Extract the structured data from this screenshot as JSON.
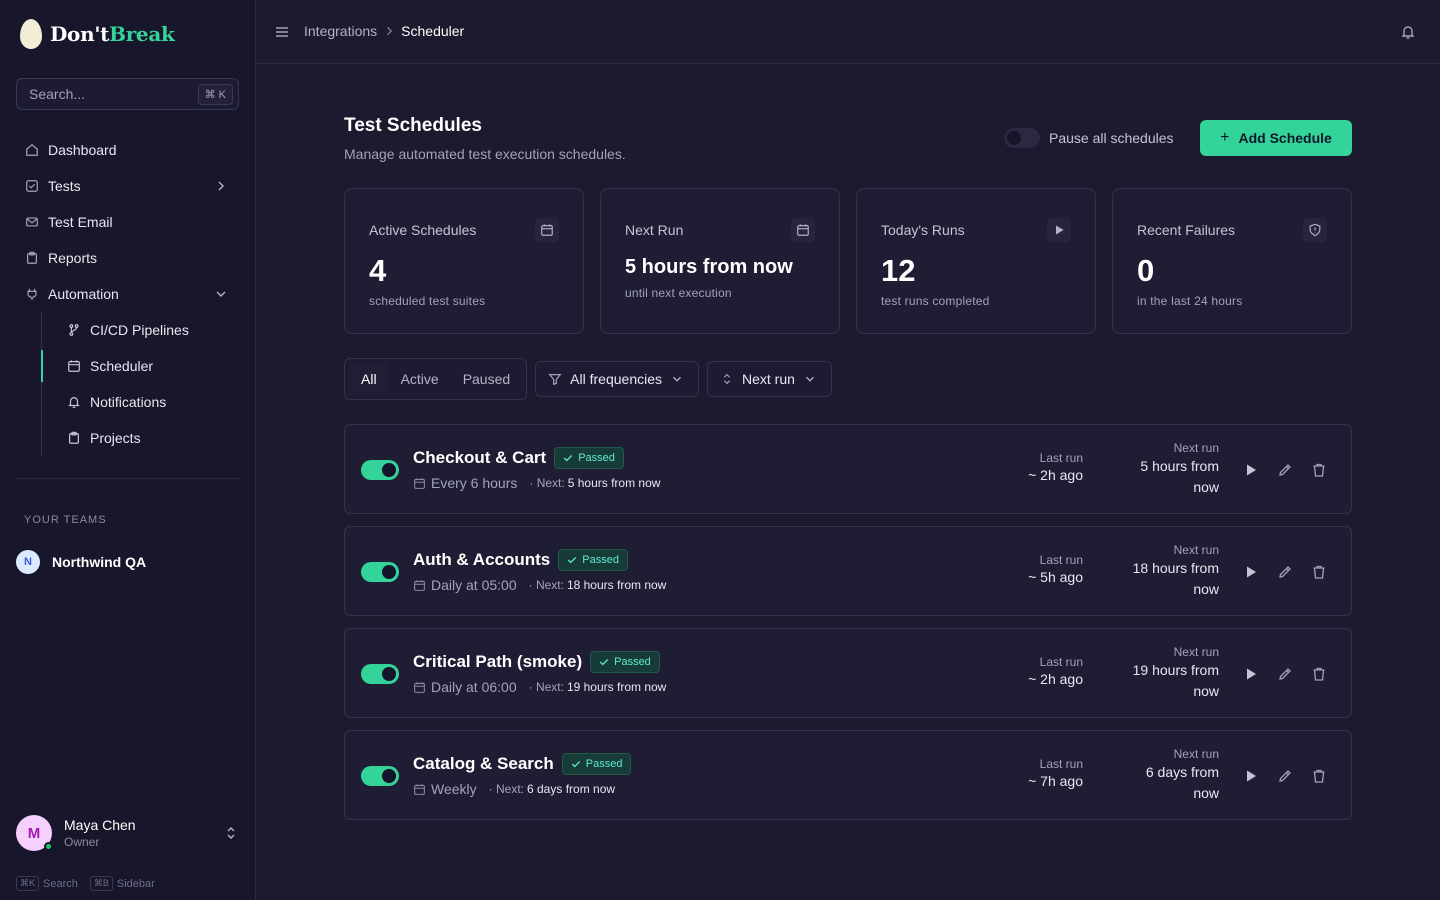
{
  "app": {
    "logo_part1": "Don't",
    "logo_part2": "Break"
  },
  "sidebar": {
    "search_placeholder": "Search...",
    "search_shortcut": "⌘ K",
    "nav": [
      {
        "label": "Dashboard",
        "icon": "home-icon"
      },
      {
        "label": "Tests",
        "icon": "checkbox-icon"
      },
      {
        "label": "Test Email",
        "icon": "mail-icon"
      },
      {
        "label": "Reports",
        "icon": "clipboard-icon"
      },
      {
        "label": "Automation",
        "icon": "plug-icon"
      }
    ],
    "automation_items": [
      {
        "label": "CI/CD Pipelines",
        "icon": "git-branch-icon"
      },
      {
        "label": "Scheduler",
        "icon": "calendar-icon",
        "active": true
      },
      {
        "label": "Notifications",
        "icon": "bell-icon"
      },
      {
        "label": "Projects",
        "icon": "clipboard-icon"
      }
    ],
    "teams_label": "YOUR TEAMS",
    "team": {
      "initial": "N",
      "name": "Northwind QA"
    },
    "user": {
      "initial": "M",
      "name": "Maya Chen",
      "role": "Owner"
    },
    "shortcuts": [
      {
        "key": "⌘K",
        "label": "Search"
      },
      {
        "key": "⌘B",
        "label": "Sidebar"
      }
    ]
  },
  "topbar": {
    "crumb_parent": "Integrations",
    "crumb_current": "Scheduler"
  },
  "page": {
    "title": "Test Schedules",
    "subtitle": "Manage automated test execution schedules.",
    "pause_label": "Pause all schedules",
    "add_label": "Add Schedule"
  },
  "stats": [
    {
      "label": "Active Schedules",
      "value": "4",
      "sub": "scheduled test suites",
      "icon": "calendar-icon"
    },
    {
      "label": "Next Run",
      "value": "5 hours from now",
      "sub": "until next execution",
      "icon": "calendar-icon"
    },
    {
      "label": "Today's Runs",
      "value": "12",
      "sub": "test runs completed",
      "icon": "play-icon"
    },
    {
      "label": "Recent Failures",
      "value": "0",
      "sub": "in the last 24 hours",
      "icon": "shield-icon"
    }
  ],
  "filters": {
    "tabs": [
      "All",
      "Active",
      "Paused"
    ],
    "frequency": "All frequencies",
    "sort": "Next run"
  },
  "schedules": [
    {
      "name": "Checkout & Cart",
      "status": "Passed",
      "frequency": "Every 6 hours",
      "next_prefix": "· Next:",
      "next_inline": "5 hours from now",
      "last_label": "Last run",
      "last_value": "~ 2h ago",
      "next_label": "Next run",
      "next_value_1": "5 hours from",
      "next_value_2": "now"
    },
    {
      "name": "Auth & Accounts",
      "status": "Passed",
      "frequency": "Daily at 05:00",
      "next_prefix": "· Next:",
      "next_inline": "18 hours from now",
      "last_label": "Last run",
      "last_value": "~ 5h ago",
      "next_label": "Next run",
      "next_value_1": "18 hours from",
      "next_value_2": "now"
    },
    {
      "name": "Critical Path (smoke)",
      "status": "Passed",
      "frequency": "Daily at 06:00",
      "next_prefix": "· Next:",
      "next_inline": "19 hours from now",
      "last_label": "Last run",
      "last_value": "~ 2h ago",
      "next_label": "Next run",
      "next_value_1": "19 hours from",
      "next_value_2": "now"
    },
    {
      "name": "Catalog & Search",
      "status": "Passed",
      "frequency": "Weekly",
      "next_prefix": "· Next:",
      "next_inline": "6 days from now",
      "last_label": "Last run",
      "last_value": "~ 7h ago",
      "next_label": "Next run",
      "next_value_1": "6 days from",
      "next_value_2": "now"
    }
  ],
  "colors": {
    "accent": "#34d399",
    "background": "#1b1a2e",
    "sidebar": "#17162a"
  }
}
